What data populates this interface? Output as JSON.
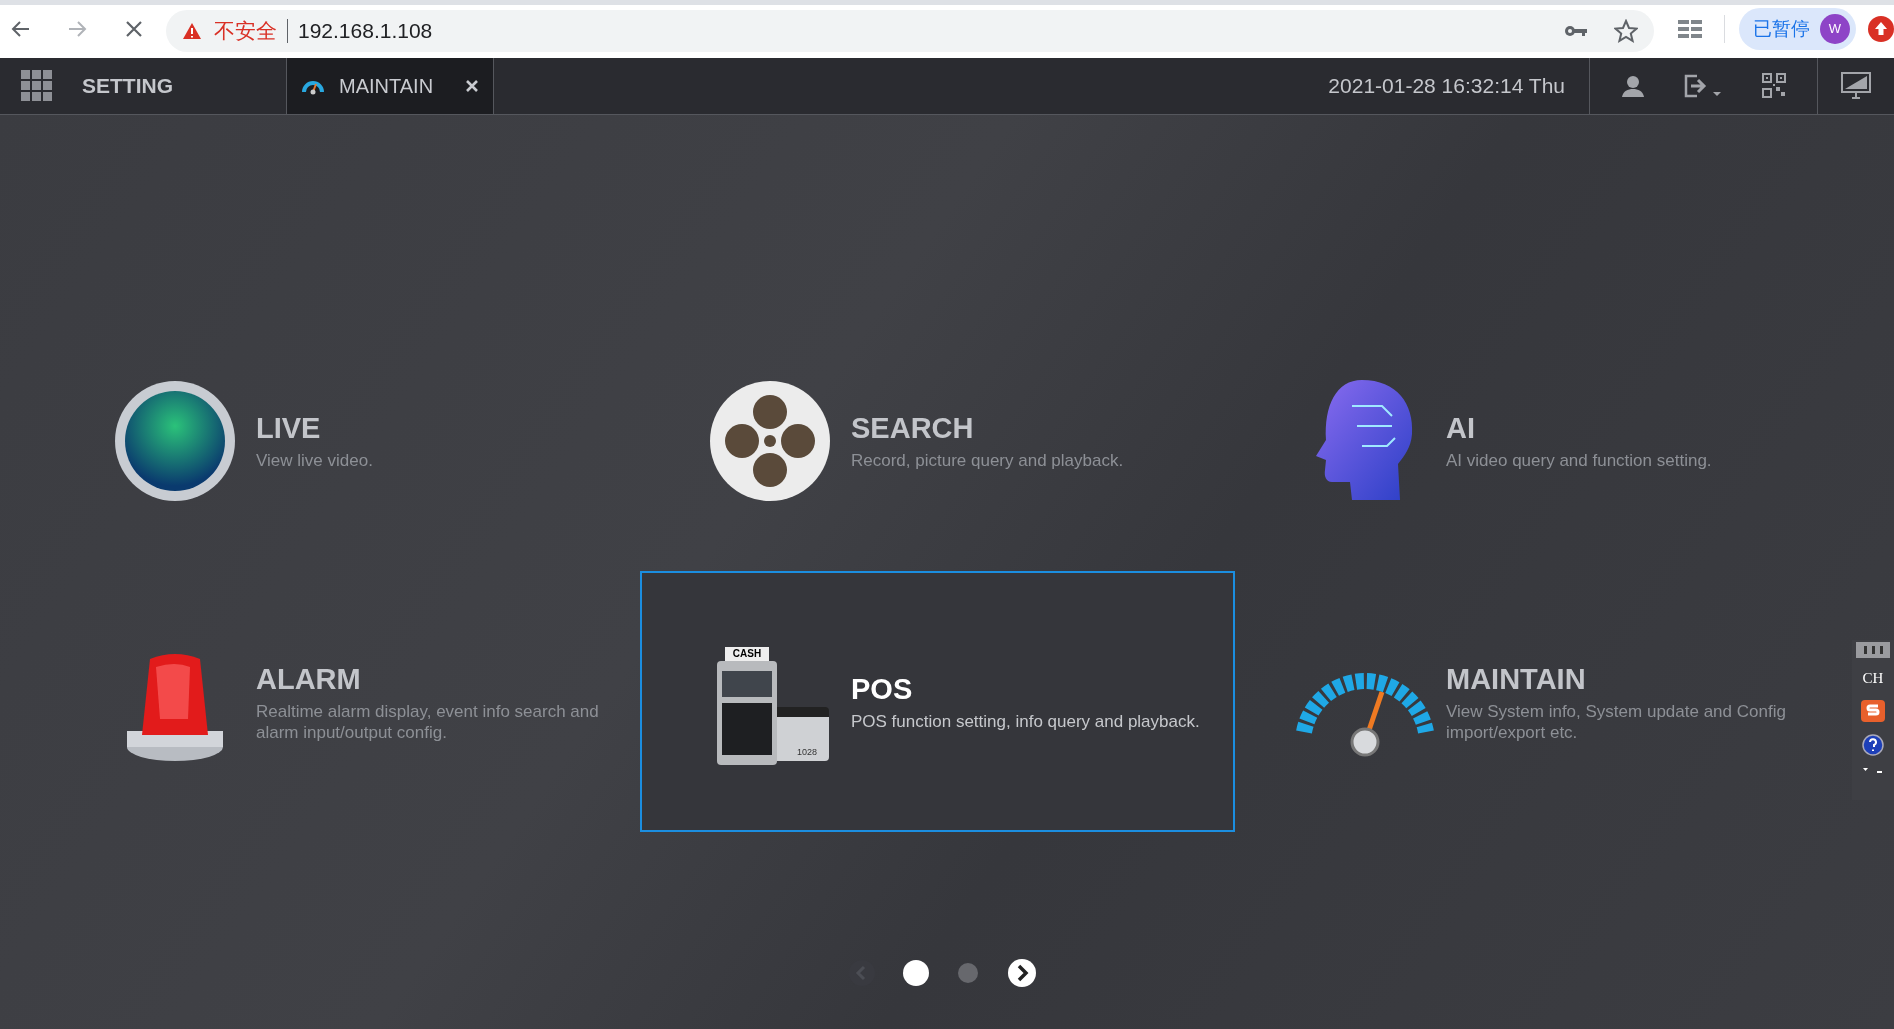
{
  "browser": {
    "security_label": "不安全",
    "url": "192.168.1.108",
    "profile_status": "已暂停",
    "avatar_letter": "W"
  },
  "header": {
    "title": "SETTING",
    "tabs": [
      {
        "label": "MAINTAIN",
        "selected": true
      }
    ],
    "datetime": "2021-01-28 16:32:14 Thu"
  },
  "tiles": [
    {
      "kind": "globe",
      "title": "LIVE",
      "description": "View live video.",
      "selected": false
    },
    {
      "kind": "reel",
      "title": "SEARCH",
      "description": "Record, picture query and playback.",
      "selected": false
    },
    {
      "kind": "head",
      "title": "AI",
      "description": "AI video query and function setting.",
      "selected": false
    },
    {
      "kind": "siren",
      "title": "ALARM",
      "description": "Realtime alarm display, event info search and alarm input/output config.",
      "selected": false
    },
    {
      "kind": "pos",
      "title": "POS",
      "description": "POS function setting, info query and playback.",
      "selected": true,
      "icon_texts": [
        "CASH",
        "1028"
      ]
    },
    {
      "kind": "gauge",
      "title": "MAINTAIN",
      "description": "View System info, System update and Config import/export etc.",
      "selected": false
    }
  ],
  "pager": {
    "previous_disabled": true,
    "pages": [
      {
        "selected": true
      },
      {
        "selected": false
      }
    ]
  },
  "ime_toolbar": {
    "mode": "CH"
  }
}
